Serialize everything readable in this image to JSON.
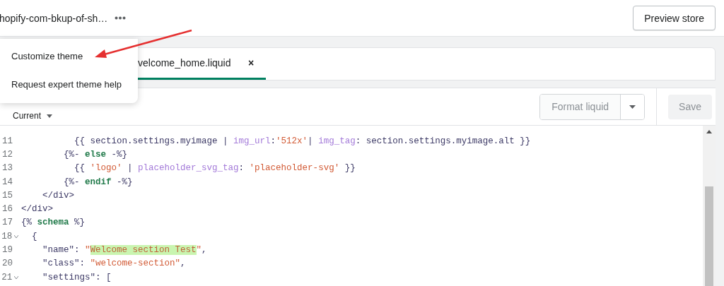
{
  "top_bar": {
    "theme_name": "hopify-com-bkup-of-sh…",
    "preview_button": "Preview store"
  },
  "menu": {
    "items": [
      {
        "label": "Customize theme"
      },
      {
        "label": "Request expert theme help"
      }
    ]
  },
  "tabs": [
    {
      "label": "velcome_home.liquid",
      "selected": true,
      "close": "×"
    }
  ],
  "toolbar": {
    "version_select": "Current",
    "format_button": "Format liquid",
    "save_button": {
      "label": "Save",
      "disabled": true
    }
  },
  "code": {
    "lines": [
      {
        "number": "11",
        "foldable": false,
        "tokens": [
          {
            "kind": "plain",
            "text": "          {{ section.settings.myimage | "
          },
          {
            "kind": "filter",
            "text": "img_url"
          },
          {
            "kind": "plain",
            "text": ":"
          },
          {
            "kind": "string",
            "text": "'512x'"
          },
          {
            "kind": "plain",
            "text": "| "
          },
          {
            "kind": "filter",
            "text": "img_tag"
          },
          {
            "kind": "plain",
            "text": ": section.settings.myimage.alt }}"
          }
        ]
      },
      {
        "number": "12",
        "foldable": false,
        "tokens": [
          {
            "kind": "plain",
            "text": "        {%- "
          },
          {
            "kind": "keyword",
            "text": "else"
          },
          {
            "kind": "plain",
            "text": " -%}"
          }
        ]
      },
      {
        "number": "13",
        "foldable": false,
        "tokens": [
          {
            "kind": "plain",
            "text": "          {{ "
          },
          {
            "kind": "string",
            "text": "'logo'"
          },
          {
            "kind": "plain",
            "text": " | "
          },
          {
            "kind": "filter",
            "text": "placeholder_svg_tag"
          },
          {
            "kind": "plain",
            "text": ": "
          },
          {
            "kind": "string",
            "text": "'placeholder-svg'"
          },
          {
            "kind": "plain",
            "text": " }}"
          }
        ]
      },
      {
        "number": "14",
        "foldable": false,
        "tokens": [
          {
            "kind": "plain",
            "text": "        {%- "
          },
          {
            "kind": "keyword",
            "text": "endif"
          },
          {
            "kind": "plain",
            "text": " -%}"
          }
        ]
      },
      {
        "number": "15",
        "foldable": false,
        "tokens": [
          {
            "kind": "plain",
            "text": "    </div>"
          }
        ]
      },
      {
        "number": "16",
        "foldable": false,
        "tokens": [
          {
            "kind": "plain",
            "text": "</div>"
          }
        ]
      },
      {
        "number": "17",
        "foldable": false,
        "tokens": [
          {
            "kind": "plain",
            "text": "{% "
          },
          {
            "kind": "keyword",
            "text": "schema"
          },
          {
            "kind": "plain",
            "text": " %}"
          }
        ]
      },
      {
        "number": "18",
        "foldable": true,
        "tokens": [
          {
            "kind": "plain",
            "text": "  {"
          }
        ]
      },
      {
        "number": "19",
        "foldable": false,
        "tokens": [
          {
            "kind": "plain",
            "text": "    \"name\": "
          },
          {
            "kind": "string",
            "text": "\""
          },
          {
            "kind": "match",
            "text": "Welcome section Test"
          },
          {
            "kind": "string",
            "text": "\""
          },
          {
            "kind": "plain",
            "text": ","
          }
        ]
      },
      {
        "number": "20",
        "foldable": false,
        "tokens": [
          {
            "kind": "plain",
            "text": "    \"class\": "
          },
          {
            "kind": "string",
            "text": "\"welcome-section\""
          },
          {
            "kind": "plain",
            "text": ","
          }
        ]
      },
      {
        "number": "21",
        "foldable": true,
        "tokens": [
          {
            "kind": "plain",
            "text": "    \"settings\": ["
          }
        ]
      }
    ]
  }
}
